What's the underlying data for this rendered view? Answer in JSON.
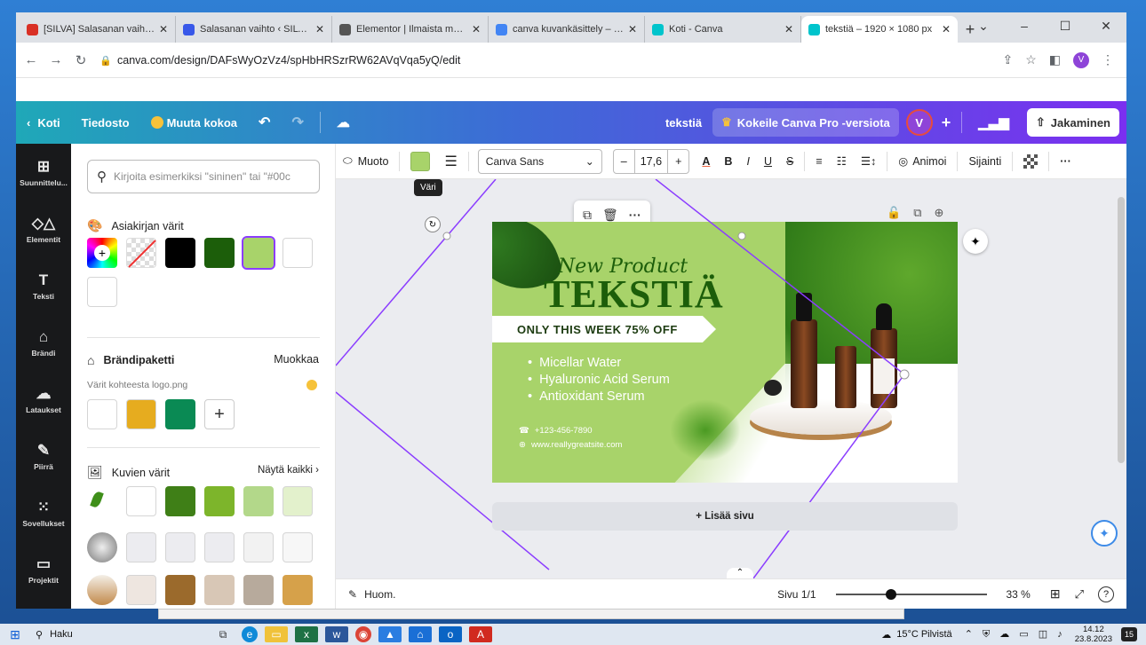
{
  "browser": {
    "tabs": [
      {
        "icon": "gmail-icon",
        "title": "[SILVA] Salasanan vaihto -",
        "color": "#d93025"
      },
      {
        "icon": "wp-icon",
        "title": "Salasanan vaihto ‹ SILVA —",
        "color": "#3858e9"
      },
      {
        "icon": "elementor-icon",
        "title": "Elementor | Ilmaista mainc",
        "color": "#555"
      },
      {
        "icon": "google-icon",
        "title": "canva kuvankäsittely – Go",
        "color": "#4285f4"
      },
      {
        "icon": "canva-icon",
        "title": "Koti - Canva",
        "color": "#00c4cc"
      },
      {
        "icon": "canva-icon",
        "title": "tekstiä – 1920 × 1080 px",
        "color": "#00c4cc"
      }
    ],
    "url": "canva.com/design/DAFsWyOzVz4/spHbHRSzrRW62AVqVqa5yQ/edit",
    "profile_initial": "V"
  },
  "topbar": {
    "home": "Koti",
    "file": "Tiedosto",
    "resize": "Muuta kokoa",
    "doc_name": "tekstiä",
    "pro": "Kokeile Canva Pro -versiota",
    "user_initial": "V",
    "share": "Jakaminen"
  },
  "leftnav": [
    {
      "label": "Suunnittelu...",
      "icon": "⊞"
    },
    {
      "label": "Elementit",
      "icon": "◇△"
    },
    {
      "label": "Teksti",
      "icon": "T"
    },
    {
      "label": "Brändi",
      "icon": "⌂"
    },
    {
      "label": "Lataukset",
      "icon": "☁"
    },
    {
      "label": "Piirrä",
      "icon": "✎"
    },
    {
      "label": "Sovellukset",
      "icon": "⁙"
    },
    {
      "label": "Projektit",
      "icon": "▭"
    }
  ],
  "panel": {
    "search_placeholder": "Kirjoita esimerkiksi \"sininen\" tai \"#00c",
    "doc_colors_title": "Asiakirjan värit",
    "brand_title": "Brändipaketti",
    "brand_edit": "Muokkaa",
    "brand_sub": "Värit kohteesta logo.png",
    "image_colors_title": "Kuvien värit",
    "show_all": "Näytä kaikki",
    "doc_colors": [
      "#000000",
      "#1c5e0a",
      "#a8d36a",
      "#ffffff",
      "#ffffff"
    ],
    "brand_colors": [
      "#ffffff",
      "#e6ac1f",
      "#0a8a54"
    ],
    "image_colors_row1": [
      "#ffffff",
      "#3f7f17",
      "#7db52b",
      "#b3d88a",
      "#e3f1cc"
    ],
    "image_colors_row2": [
      "#ececf0",
      "#ececf0",
      "#ececf0",
      "#f2f2f2",
      "#f7f7f7"
    ],
    "image_colors_row3": [
      "#eee6e0",
      "#9b6a2c",
      "#d8c7b6",
      "#b7aa9c",
      "#d6a14a"
    ]
  },
  "editbar": {
    "shape": "Muoto",
    "font": "Canva Sans",
    "size": "17,6",
    "animate": "Animoi",
    "position": "Sijainti",
    "tooltip": "Väri",
    "color": "#a8d36a"
  },
  "design": {
    "script_title": "New Product",
    "title": "TEKSTIÄ",
    "banner": "ONLY THIS WEEK 75% OFF",
    "bullets": [
      "Micellar Water",
      "Hyaluronic Acid Serum",
      "Antioxidant Serum"
    ],
    "phone": "+123-456-7890",
    "website": "www.reallygreatsite.com"
  },
  "canvas": {
    "add_page": "+ Lisää sivu"
  },
  "bottombar": {
    "notes": "Huom.",
    "page": "Sivu 1/1",
    "zoom": "33 %",
    "zoom_level": 0.33
  },
  "taskbar": {
    "search": "Haku",
    "weather": "15°C Pilvistä",
    "time": "14.12",
    "date": "23.8.2023",
    "badge": "15"
  }
}
